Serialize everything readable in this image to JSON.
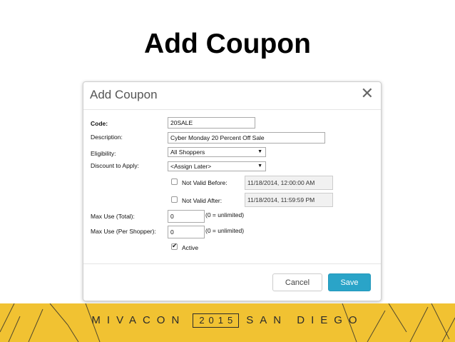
{
  "slide": {
    "title": "Add Coupon"
  },
  "dialog": {
    "title": "Add Coupon",
    "close_icon": "close-icon",
    "fields": {
      "code_label": "Code:",
      "code_value": "20SALE",
      "description_label": "Description:",
      "description_value": "Cyber Monday 20 Percent Off Sale",
      "eligibility_label": "Eligibility:",
      "eligibility_value": "All Shoppers",
      "discount_label": "Discount to Apply:",
      "discount_value": "<Assign Later>",
      "not_valid_before_label": "Not Valid Before:",
      "not_valid_before_value": "11/18/2014, 12:00:00 AM",
      "not_valid_after_label": "Not Valid After:",
      "not_valid_after_value": "11/18/2014, 11:59:59 PM",
      "max_use_total_label": "Max Use (Total):",
      "max_use_total_value": "0",
      "max_use_total_hint": "(0 = unlimited)",
      "max_use_shopper_label": "Max Use (Per Shopper):",
      "max_use_shopper_value": "0",
      "max_use_shopper_hint": "(0 = unlimited)",
      "active_label": "Active"
    },
    "checkboxes": {
      "not_valid_before": false,
      "not_valid_after": false,
      "active": true
    },
    "buttons": {
      "cancel": "Cancel",
      "save": "Save"
    }
  },
  "footer": {
    "brand_name": "MIVACON",
    "year": "2015",
    "location": "SAN DIEGO",
    "color": "#f1c232"
  }
}
